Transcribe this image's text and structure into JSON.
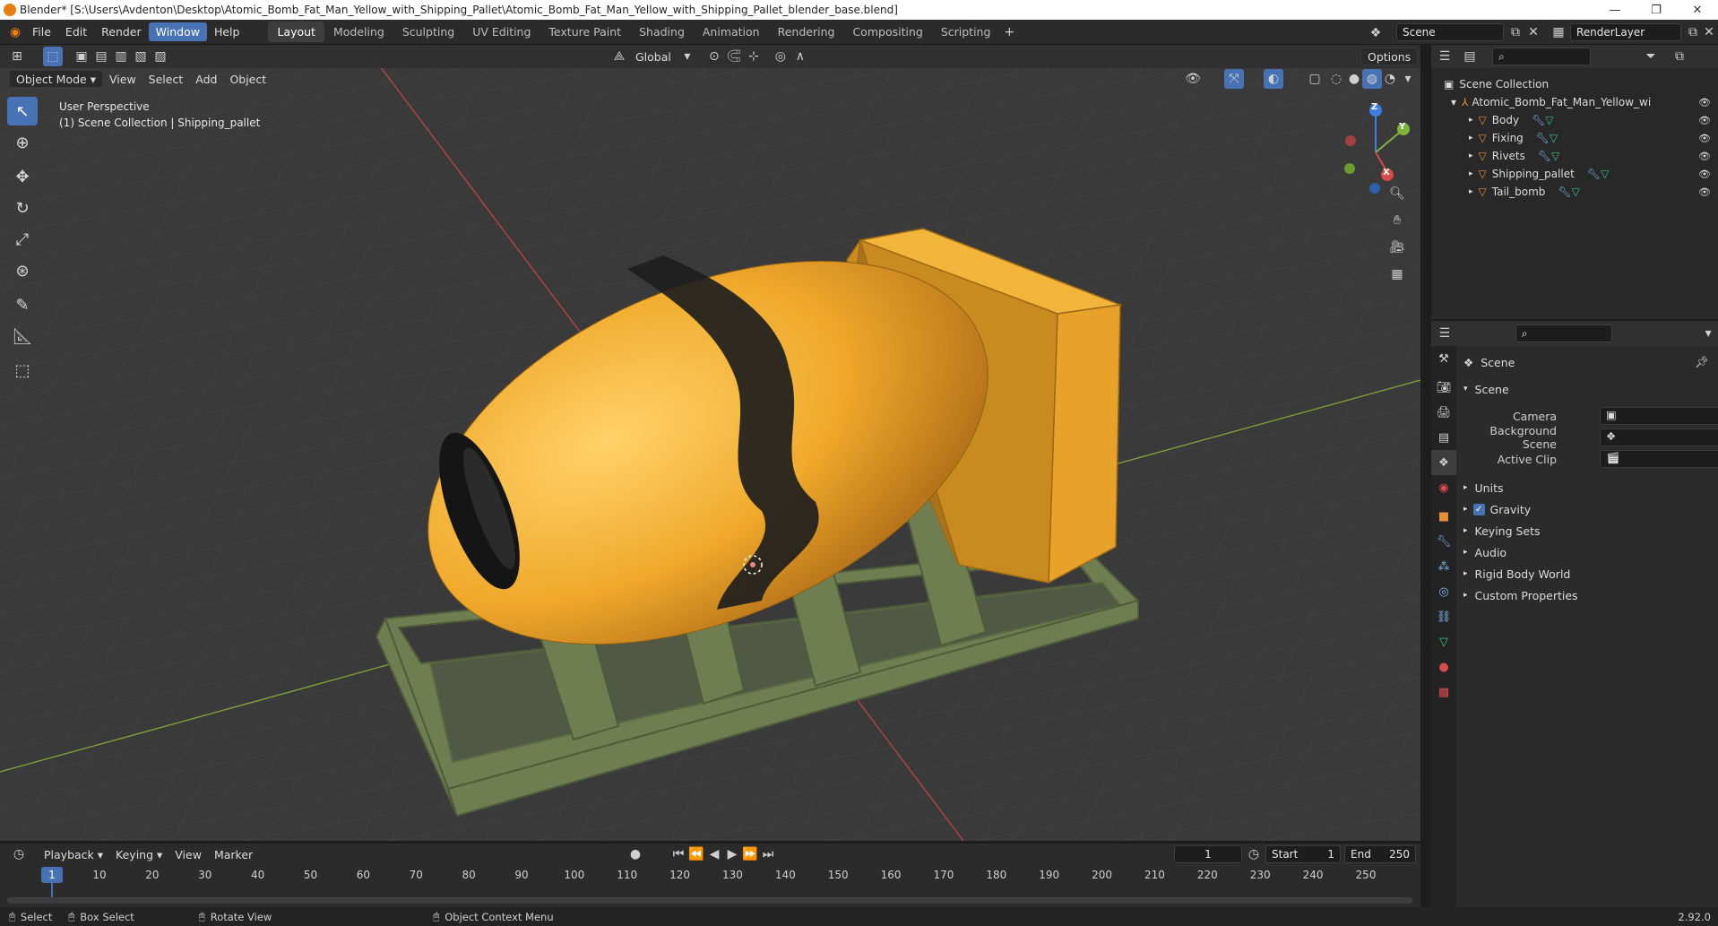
{
  "titlebar": {
    "title": "Blender* [S:\\Users\\Avdenton\\Desktop\\Atomic_Bomb_Fat_Man_Yellow_with_Shipping_Pallet\\Atomic_Bomb_Fat_Man_Yellow_with_Shipping_Pallet_blender_base.blend]",
    "min": "—",
    "max": "❐",
    "close": "✕"
  },
  "menu": {
    "file": "File",
    "edit": "Edit",
    "render": "Render",
    "window": "Window",
    "help": "Help"
  },
  "workspaces": [
    "Layout",
    "Modeling",
    "Sculpting",
    "UV Editing",
    "Texture Paint",
    "Shading",
    "Animation",
    "Rendering",
    "Compositing",
    "Scripting"
  ],
  "scene": {
    "name": "Scene",
    "render_layer": "RenderLayer"
  },
  "viewport": {
    "mode": "Object Mode",
    "view": "View",
    "select": "Select",
    "add": "Add",
    "object": "Object",
    "transform_orientation": "Global",
    "options": "Options",
    "perspective": "User Perspective",
    "collection_info": "(1) Scene Collection | Shipping_pallet",
    "gizmo": {
      "x": "X",
      "y": "Y",
      "z": "Z"
    }
  },
  "outliner": {
    "root": "Scene Collection",
    "collection": "Atomic_Bomb_Fat_Man_Yellow_with_Shippi",
    "objects": [
      "Body",
      "Fixing",
      "Rivets",
      "Shipping_pallet",
      "Tail_bomb"
    ]
  },
  "properties": {
    "context": "Scene",
    "panel": "Scene",
    "camera_label": "Camera",
    "background_label": "Background Scene",
    "clip_label": "Active Clip",
    "sections": [
      "Units",
      "Gravity",
      "Keying Sets",
      "Audio",
      "Rigid Body World",
      "Custom Properties"
    ]
  },
  "timeline": {
    "playback": "Playback",
    "keying": "Keying",
    "view": "View",
    "marker": "Marker",
    "current_frame": "1",
    "start_label": "Start",
    "start": "1",
    "end_label": "End",
    "end": "250",
    "ticks": [
      "1",
      "10",
      "20",
      "30",
      "40",
      "50",
      "60",
      "70",
      "80",
      "90",
      "100",
      "110",
      "120",
      "130",
      "140",
      "150",
      "160",
      "170",
      "180",
      "190",
      "200",
      "210",
      "220",
      "230",
      "240",
      "250"
    ]
  },
  "status": {
    "select": "Select",
    "box_select": "Box Select",
    "rotate": "Rotate View",
    "context_menu": "Object Context Menu",
    "version": "2.92.0"
  },
  "colors": {
    "accent": "#4772b3",
    "bomb": "#f0a92a",
    "pallet": "#6f7f52",
    "axis_x": "#d94a4a",
    "axis_y": "#7fb33a",
    "axis_z": "#3d7fe0"
  }
}
